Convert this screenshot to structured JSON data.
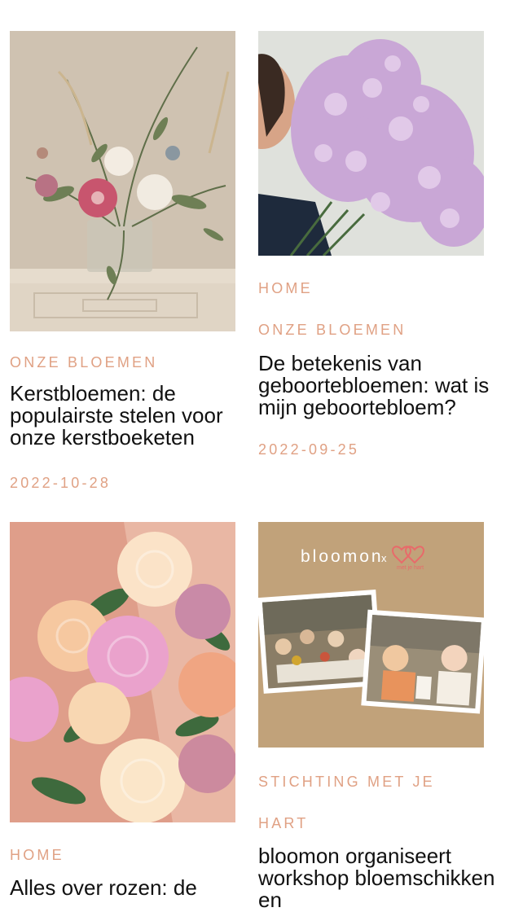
{
  "posts": [
    {
      "categories": [
        "ONZE BLOEMEN"
      ],
      "title": "Kerstbloemen: de populairste stelen voor onze kerstboeketen",
      "date": "2022-10-28",
      "image_alt": "Kerstboeket in vaas op schouw"
    },
    {
      "categories": [
        "HOME",
        "ONZE BLOEMEN"
      ],
      "title": "De betekenis van geboortebloemen: wat is mijn geboortebloem?",
      "date": "2022-09-25",
      "image_alt": "Vrouw met lila ridderspoor"
    },
    {
      "categories": [
        "HOME"
      ],
      "title": "Alles over rozen: de",
      "date": "",
      "image_alt": "Boeket rozen in pasteltinten"
    },
    {
      "categories": [
        "STICHTING MET JE",
        "HART"
      ],
      "title": "bloomon organiseert workshop bloemschikken en",
      "date": "",
      "image_alt": "bloomon x met je hart workshop foto's",
      "logo_text": "bloomon",
      "partner_text": "met je hart"
    }
  ]
}
